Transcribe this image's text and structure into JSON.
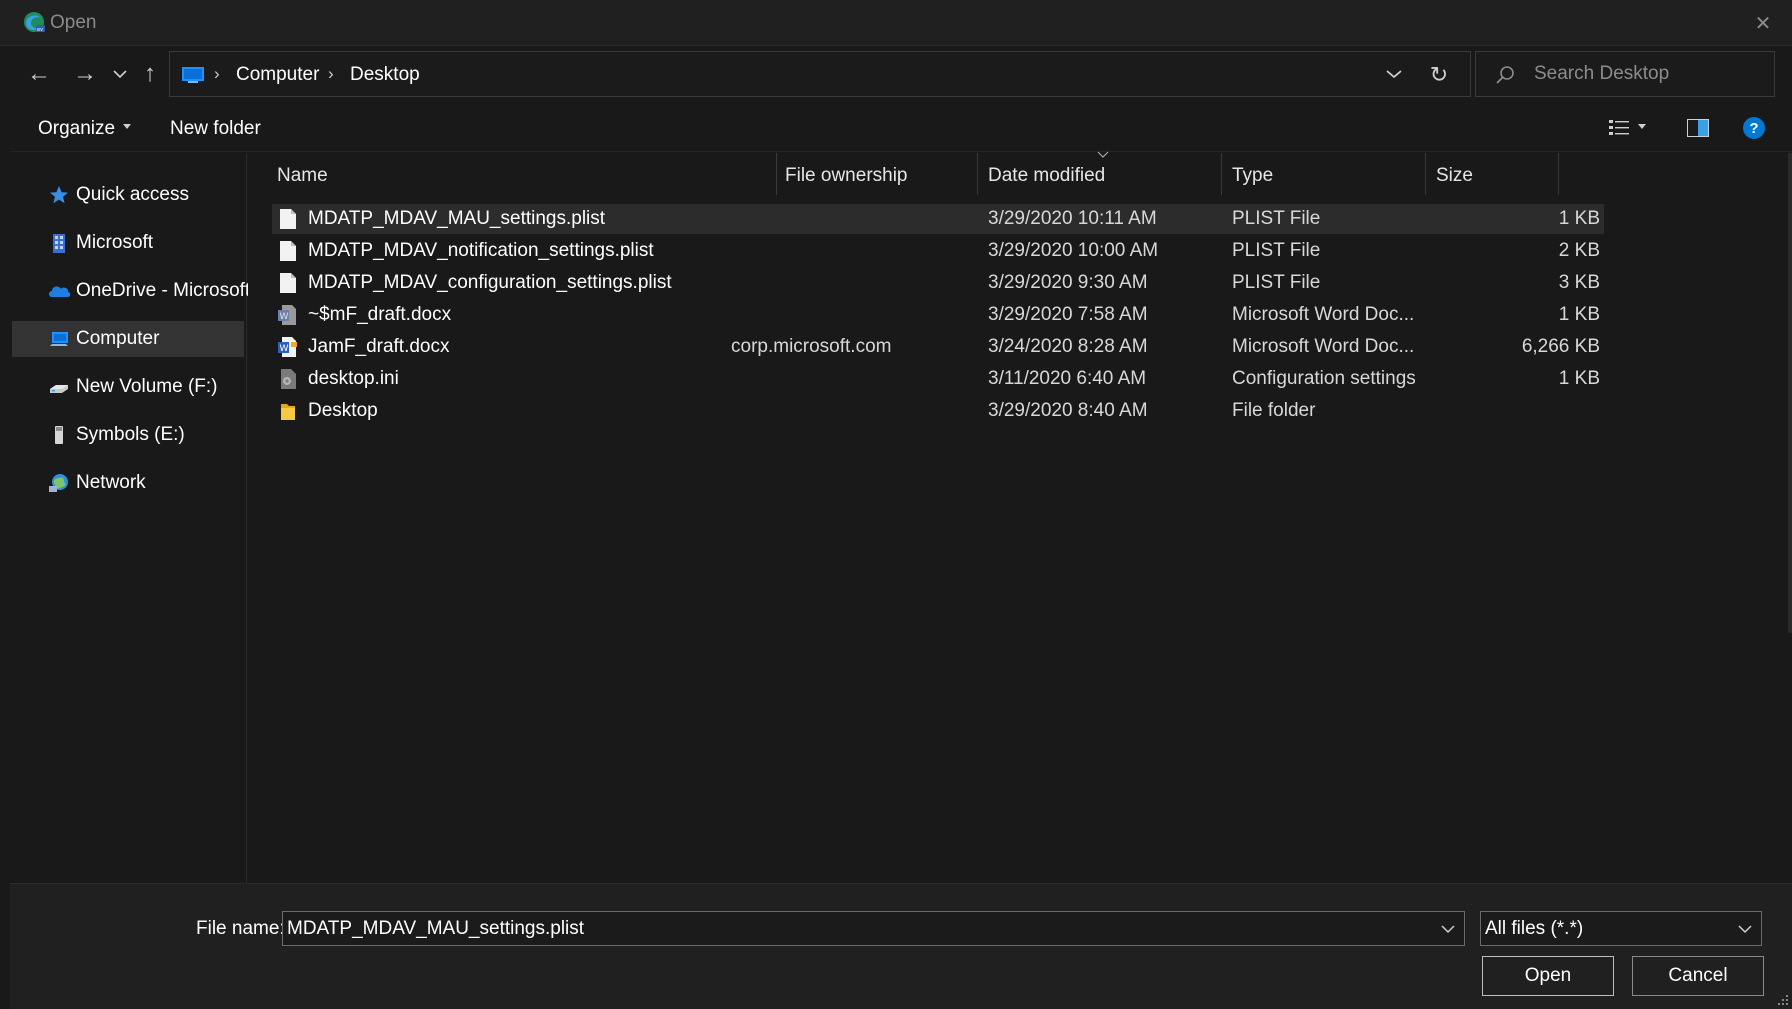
{
  "window": {
    "title": "Open",
    "close_glyph": "✕"
  },
  "nav": {
    "back_glyph": "←",
    "forward_glyph": "→",
    "recent_glyph": "⌄",
    "up_glyph": "↑"
  },
  "address": {
    "separator": "›",
    "crumbs": [
      "Computer",
      "Desktop"
    ],
    "refresh_glyph": "↻"
  },
  "search": {
    "placeholder": "Search Desktop"
  },
  "toolbar": {
    "organize_label": "Organize",
    "new_folder_label": "New folder",
    "help_glyph": "?"
  },
  "sidebar": {
    "items": [
      {
        "label": "Quick access",
        "icon": "star-icon"
      },
      {
        "label": "Microsoft",
        "icon": "building-icon"
      },
      {
        "label": "OneDrive - Microsoft",
        "icon": "cloud-icon"
      },
      {
        "label": "Computer",
        "icon": "computer-icon",
        "selected": true
      },
      {
        "label": "New Volume (F:)",
        "icon": "drive-icon"
      },
      {
        "label": "Symbols (E:)",
        "icon": "usb-drive-icon"
      },
      {
        "label": "Network",
        "icon": "network-icon"
      }
    ]
  },
  "columns": {
    "name": "Name",
    "ownership": "File ownership",
    "date": "Date modified",
    "type": "Type",
    "size": "Size"
  },
  "files": [
    {
      "name": "MDATP_MDAV_MAU_settings.plist",
      "owner": "",
      "date": "3/29/2020 10:11 AM",
      "type": "PLIST File",
      "size": "1 KB",
      "icon": "document-icon",
      "selected": true
    },
    {
      "name": "MDATP_MDAV_notification_settings.plist",
      "owner": "",
      "date": "3/29/2020 10:00 AM",
      "type": "PLIST File",
      "size": "2 KB",
      "icon": "document-icon"
    },
    {
      "name": "MDATP_MDAV_configuration_settings.plist",
      "owner": "",
      "date": "3/29/2020 9:30 AM",
      "type": "PLIST File",
      "size": "3 KB",
      "icon": "document-icon"
    },
    {
      "name": "~$mF_draft.docx",
      "owner": "",
      "date": "3/29/2020 7:58 AM",
      "type": "Microsoft Word Doc...",
      "size": "1 KB",
      "icon": "word-doc-icon"
    },
    {
      "name": "JamF_draft.docx",
      "owner": "corp.microsoft.com",
      "date": "3/24/2020 8:28 AM",
      "type": "Microsoft Word Doc...",
      "size": "6,266 KB",
      "icon": "word-doc-icon"
    },
    {
      "name": "desktop.ini",
      "owner": "",
      "date": "3/11/2020 6:40 AM",
      "type": "Configuration settings",
      "size": "1 KB",
      "icon": "settings-file-icon"
    },
    {
      "name": "Desktop",
      "owner": "",
      "date": "3/29/2020 8:40 AM",
      "type": "File folder",
      "size": "",
      "icon": "folder-icon"
    }
  ],
  "footer": {
    "file_name_label": "File name:",
    "file_name_value": "MDATP_MDAV_MAU_settings.plist",
    "file_type_value": "All files (*.*)",
    "open_label": "Open",
    "cancel_label": "Cancel"
  },
  "colors": {
    "background": "#191919",
    "selection": "#2c2c2c",
    "nav_selected": "#333333",
    "accent_blue": "#0078d4",
    "folder_yellow": "#f0c040"
  }
}
